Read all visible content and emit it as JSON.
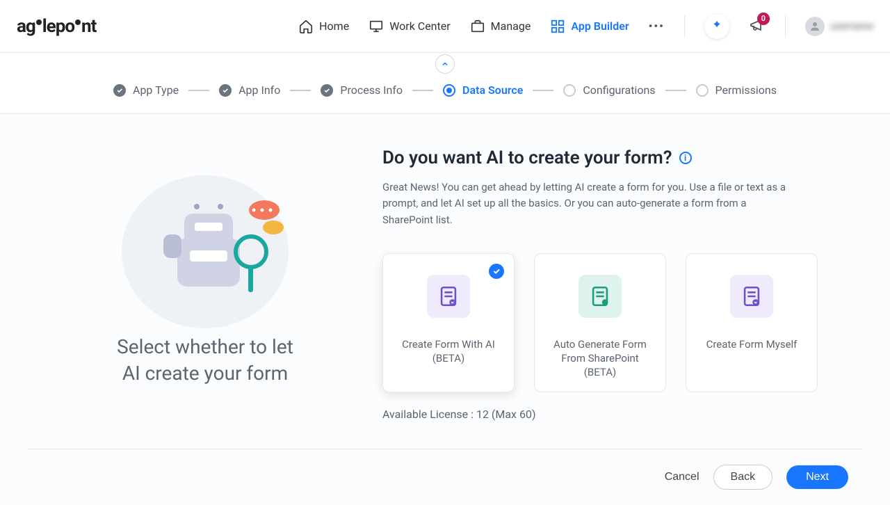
{
  "header": {
    "brand": "agilepoint",
    "nav": {
      "home": "Home",
      "work": "Work Center",
      "manage": "Manage",
      "app": "App Builder"
    },
    "badge": "0",
    "user": "username"
  },
  "stepper": {
    "s1": "App Type",
    "s2": "App Info",
    "s3": "Process Info",
    "s4": "Data Source",
    "s5": "Configurations",
    "s6": "Permissions"
  },
  "left": {
    "title_l1": "Select whether to let",
    "title_l2": "AI create your form"
  },
  "right": {
    "question": "Do you want AI to create your form?",
    "desc": "Great News! You can get ahead by letting AI create a form for you. Use a file or text as a prompt, and let AI set up all the basics. Or you can auto-generate a form from a SharePoint list.",
    "card1": "Create Form With AI (BETA)",
    "card2": "Auto Generate Form From SharePoint (BETA)",
    "card3": "Create Form Myself",
    "license": "Available License : 12 (Max 60)"
  },
  "footer": {
    "cancel": "Cancel",
    "back": "Back",
    "next": "Next"
  }
}
